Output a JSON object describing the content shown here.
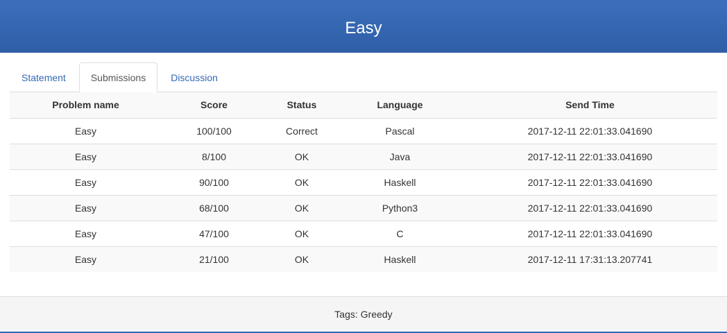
{
  "header": {
    "title": "Easy"
  },
  "tabs": [
    {
      "label": "Statement",
      "active": false
    },
    {
      "label": "Submissions",
      "active": true
    },
    {
      "label": "Discussion",
      "active": false
    }
  ],
  "table": {
    "columns": [
      "Problem name",
      "Score",
      "Status",
      "Language",
      "Send Time"
    ],
    "rows": [
      [
        "Easy",
        "100/100",
        "Correct",
        "Pascal",
        "2017-12-11 22:01:33.041690"
      ],
      [
        "Easy",
        "8/100",
        "OK",
        "Java",
        "2017-12-11 22:01:33.041690"
      ],
      [
        "Easy",
        "90/100",
        "OK",
        "Haskell",
        "2017-12-11 22:01:33.041690"
      ],
      [
        "Easy",
        "68/100",
        "OK",
        "Python3",
        "2017-12-11 22:01:33.041690"
      ],
      [
        "Easy",
        "47/100",
        "OK",
        "C",
        "2017-12-11 22:01:33.041690"
      ],
      [
        "Easy",
        "21/100",
        "OK",
        "Haskell",
        "2017-12-11 17:31:13.207741"
      ]
    ]
  },
  "footer": {
    "tags_label": "Tags:",
    "tags": "Greedy"
  },
  "colors": {
    "header_bg": "#3368b4",
    "link": "#3568b4",
    "stripe": "#f9f9f9",
    "footer_bg": "#f5f5f5"
  }
}
